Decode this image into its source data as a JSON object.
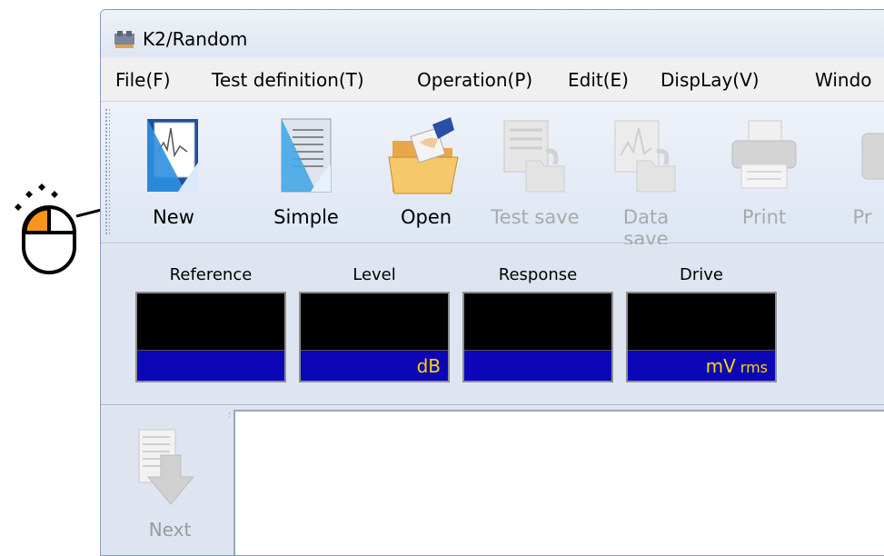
{
  "window": {
    "title": "K2/Random"
  },
  "menu": [
    {
      "label": "File(F)"
    },
    {
      "label": "Test definition(T)"
    },
    {
      "label": "Operation(P)"
    },
    {
      "label": "Edit(E)"
    },
    {
      "label": "DispLay(V)"
    },
    {
      "label": "Windo"
    }
  ],
  "toolbar": {
    "buttons": [
      {
        "label": "New",
        "icon": "new-document-icon",
        "enabled": true
      },
      {
        "label": "Simple",
        "icon": "simple-document-icon",
        "enabled": true
      },
      {
        "label": "Open",
        "icon": "open-folder-icon",
        "enabled": true
      },
      {
        "label": "Test save",
        "icon": "test-save-icon",
        "enabled": false
      },
      {
        "label": "Data save",
        "icon": "data-save-icon",
        "enabled": false
      },
      {
        "label": "Print",
        "icon": "printer-icon",
        "enabled": false
      },
      {
        "label": "Pr",
        "icon": "print-preview-icon",
        "enabled": false
      }
    ]
  },
  "gauges": [
    {
      "label": "Reference",
      "value": "",
      "unit": "",
      "unit_sub": ""
    },
    {
      "label": "Level",
      "value": "",
      "unit": "dB",
      "unit_sub": ""
    },
    {
      "label": "Response",
      "value": "",
      "unit": "",
      "unit_sub": ""
    },
    {
      "label": "Drive",
      "value": "",
      "unit": "mV",
      "unit_sub": "rms"
    }
  ],
  "side": {
    "next_label": "Next"
  },
  "annotation": {
    "pointer_icon": "mouse-left-click-icon",
    "highlight_color": "#f7941d",
    "target": "Simple"
  },
  "colors": {
    "gauge_background": "#000000",
    "gauge_unit_background": "#0b07b8",
    "gauge_unit_text": "#ffd400",
    "disabled_text": "#a9a9a9"
  }
}
